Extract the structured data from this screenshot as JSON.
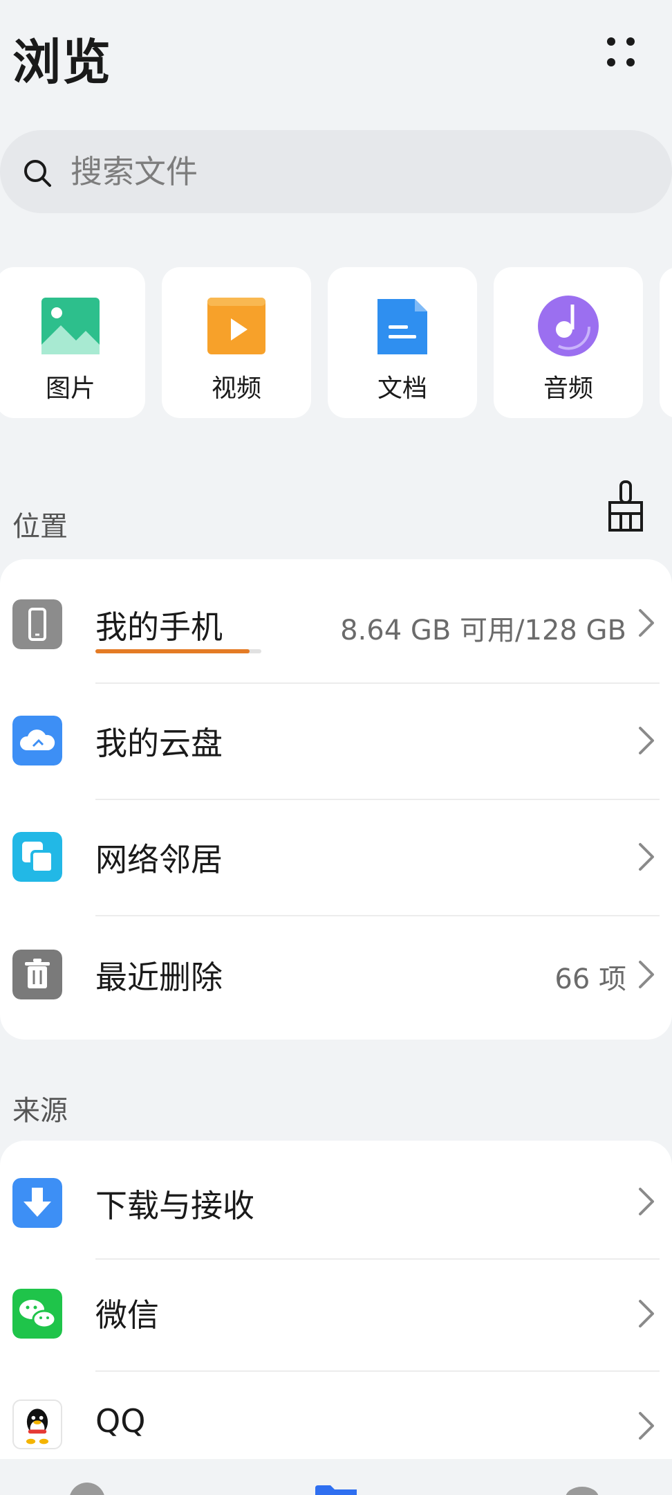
{
  "header": {
    "title": "浏览",
    "more_icon": "more-dots-icon"
  },
  "search": {
    "placeholder": "搜索文件",
    "icon": "search-icon"
  },
  "categories": [
    {
      "label": "图片",
      "icon": "image-icon",
      "color": "#2dbf8c"
    },
    {
      "label": "视频",
      "icon": "video-icon",
      "color": "#f7a12a"
    },
    {
      "label": "文档",
      "icon": "document-icon",
      "color": "#2f8ff0"
    },
    {
      "label": "音频",
      "icon": "audio-icon",
      "color": "#9b6ff0"
    }
  ],
  "locations": {
    "title": "位置",
    "clean_icon": "broom-icon",
    "items": [
      {
        "label": "我的手机",
        "meta": "8.64 GB 可用/128 GB",
        "icon": "phone-icon",
        "color": "#8c8c8c",
        "used_fraction": 0.93
      },
      {
        "label": "我的云盘",
        "meta": "",
        "icon": "cloud-icon",
        "color": "#3d8ff5"
      },
      {
        "label": "网络邻居",
        "meta": "",
        "icon": "network-icon",
        "color": "#22b8e6"
      },
      {
        "label": "最近删除",
        "meta": "66 项",
        "icon": "trash-icon",
        "color": "#7a7a7a"
      }
    ]
  },
  "sources": {
    "title": "来源",
    "items": [
      {
        "label": "下载与接收",
        "icon": "download-icon",
        "color": "#3d8ff5"
      },
      {
        "label": "微信",
        "icon": "wechat-icon",
        "color": "#1fc44a"
      },
      {
        "label": "QQ",
        "icon": "qq-icon",
        "color": "#ffffff"
      }
    ]
  }
}
